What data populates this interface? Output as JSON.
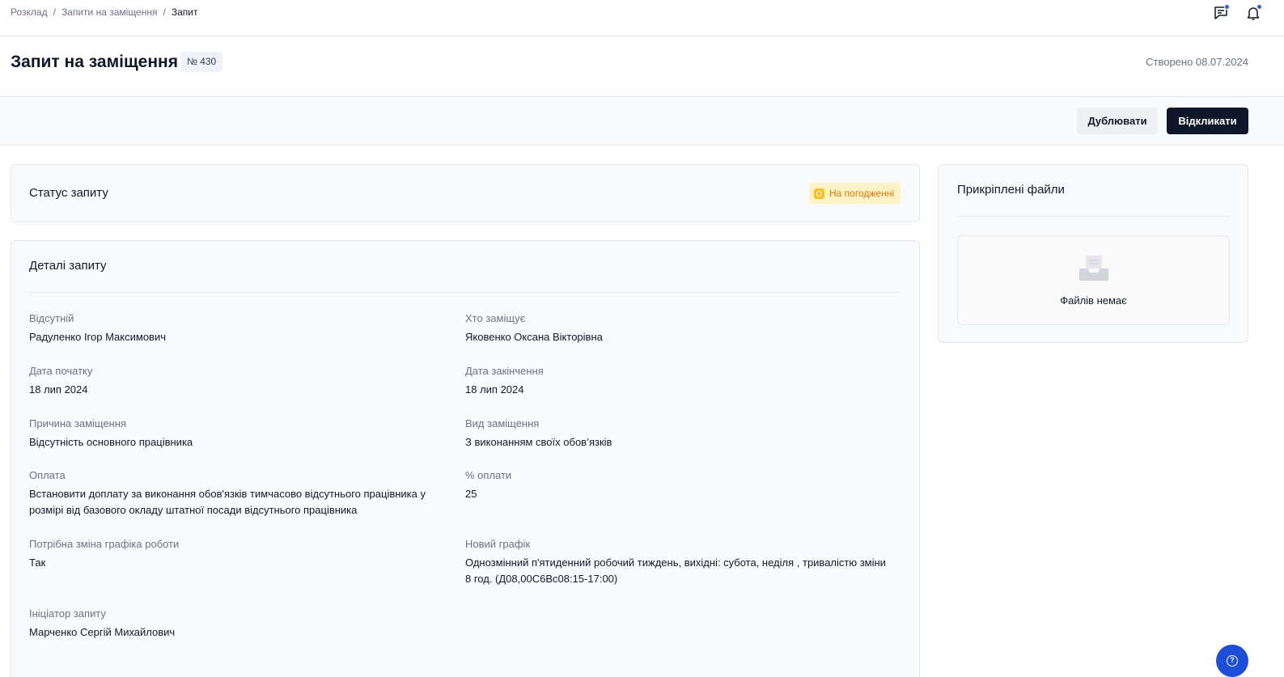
{
  "breadcrumb": {
    "items": [
      "Розклад",
      "Запити на заміщення"
    ],
    "current": "Запит",
    "separator": "/"
  },
  "header": {
    "title": "Запит на заміщення",
    "request_number": "№ 430",
    "created": "Створено 08.07.2024"
  },
  "toolbar": {
    "duplicate_label": "Дублювати",
    "respond_label": "Відкликати"
  },
  "status": {
    "title": "Статус запиту",
    "badge": "На погодженні"
  },
  "details": {
    "title": "Деталі запиту",
    "fields": [
      {
        "label": "Відсутній",
        "value": "Радуленко Ігор Максимович"
      },
      {
        "label": "Хто заміщує",
        "value": "Яковенко Оксана Вікторівна"
      },
      {
        "label": "Дата початку",
        "value": "18 лип 2024"
      },
      {
        "label": "Дата закінчення",
        "value": "18 лип 2024"
      },
      {
        "label": "Причина заміщення",
        "value": "Відсутність основного працівника"
      },
      {
        "label": "Вид заміщення",
        "value": "З виконанням своїх обов’язків"
      },
      {
        "label": "Оплата",
        "value": "Встановити доплату за виконання обов'язків тимчасово відсутнього працівника у розмірі від базового окладу штатної посади відсутнього працівника"
      },
      {
        "label": "% оплати",
        "value": "25"
      },
      {
        "label": "Потрібна зміна графіка роботи",
        "value": "Так"
      },
      {
        "label": "Новий графік",
        "value": "Однозмінний п'ятиденний робочий тиждень, вихідні: субота, неділя , тривалістю зміни 8 год. (Д08,00С6Вс08:15-17:00)"
      },
      {
        "label": "Ініціатор запиту",
        "value": "Марченко Сергій Михайлович"
      }
    ]
  },
  "files": {
    "title": "Прикріплені файли",
    "empty_text": "Файлів немає"
  },
  "colors": {
    "primary_dark": "#0f172a",
    "status_warning": "#d97706",
    "status_bg": "#fef3c7",
    "notification_dot": "#2563eb"
  },
  "icons": {
    "messages": "chat-icon",
    "notifications": "bell-icon",
    "status": "clock-icon",
    "empty_files": "inbox-tray-icon",
    "help": "help-icon"
  }
}
